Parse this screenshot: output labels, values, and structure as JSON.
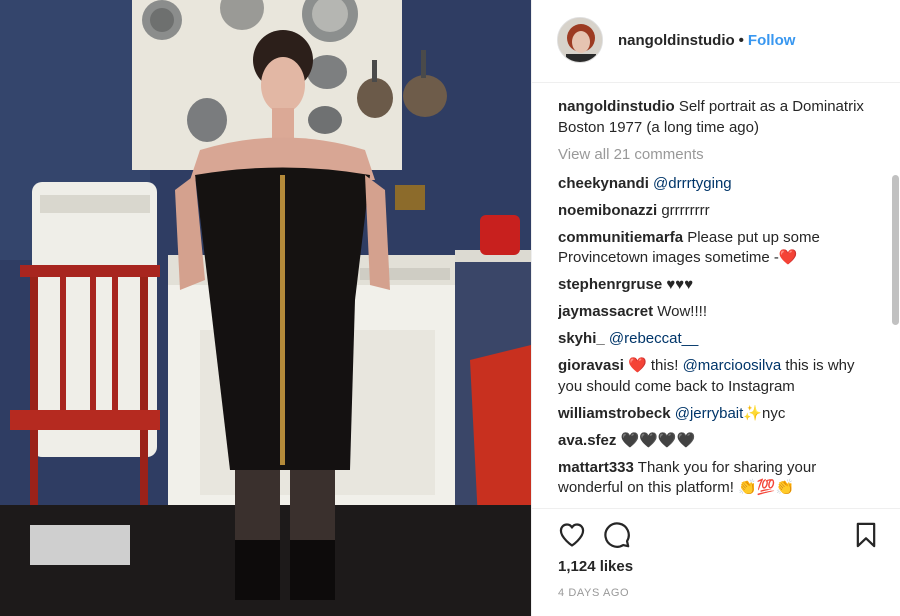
{
  "post": {
    "username": "nangoldinstudio",
    "separator": "•",
    "follow_label": "Follow",
    "caption": "Self portrait as a Dominatrix Boston 1977 (a long time ago)",
    "view_all_label": "View all 21 comments",
    "likes_label": "1,124 likes",
    "timestamp": "4 DAYS AGO"
  },
  "comments": [
    {
      "user": "cheekynandi",
      "mention": "@drrrtyging",
      "text": ""
    },
    {
      "user": "noemibonazzi",
      "text": "grrrrrrrr"
    },
    {
      "user": "communitiemarfa",
      "text": "Please put up some Provincetown images sometime -❤️"
    },
    {
      "user": "stephenrgruse",
      "text": "♥♥♥"
    },
    {
      "user": "jaymassacret",
      "text": "Wow!!!!"
    },
    {
      "user": "skyhi_",
      "mention": "@rebeccat__",
      "text": ""
    },
    {
      "user": "gioravasi",
      "text_before": "❤️ this!",
      "mention": "@marcioosilva",
      "text_after": "this is why you should come back to Instagram"
    },
    {
      "user": "williamstrobeck",
      "mention": "@jerrybait",
      "text_after": "✨nyc"
    },
    {
      "user": "ava.sfez",
      "text": "🖤🖤🖤🖤"
    },
    {
      "user": "mattart333",
      "text": "Thank you for sharing your wonderful on this platform! 👏💯👏"
    }
  ],
  "icons": {
    "like": "heart-outline-icon",
    "comment": "comment-bubble-icon",
    "save": "bookmark-icon"
  },
  "colors": {
    "follow": "#3897f0",
    "mention": "#003569",
    "muted": "#999999",
    "text": "#262626"
  }
}
